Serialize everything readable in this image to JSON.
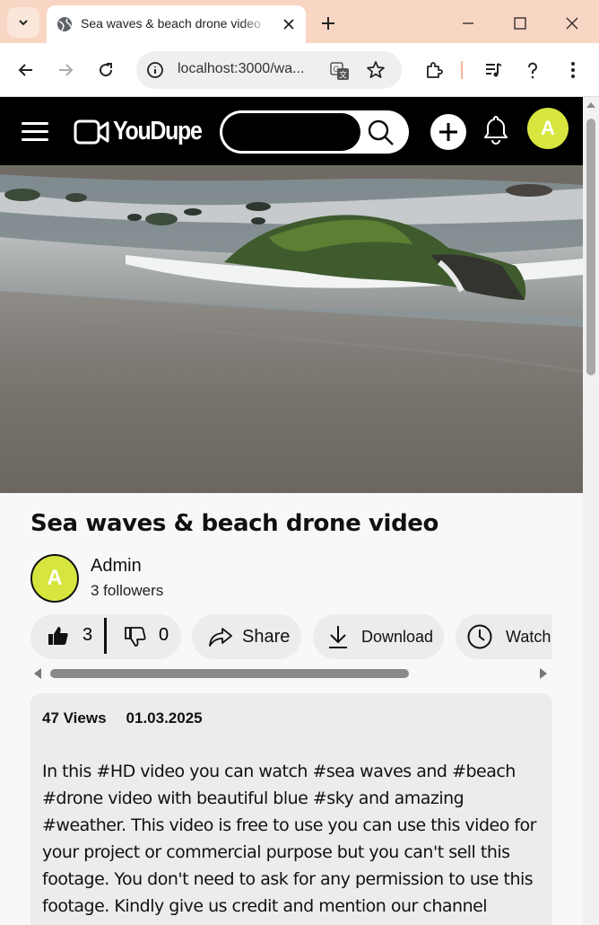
{
  "browser": {
    "tab_title": "Sea waves & beach drone video",
    "url": "localhost:3000/wa..."
  },
  "header": {
    "logo_text": "YouDupe",
    "search_value": "",
    "avatar_letter": "A"
  },
  "video": {
    "title": "Sea waves & beach drone video"
  },
  "channel": {
    "avatar_letter": "A",
    "name": "Admin",
    "followers": "3 followers"
  },
  "actions": {
    "likes": "3",
    "dislikes": "0",
    "share_label": "Share",
    "download_label": "Download",
    "watch_label": "Watch"
  },
  "description": {
    "views": "47 Views",
    "date": "01.03.2025",
    "text": "In this #HD video you can watch #sea waves and #beach #drone video with beautiful blue #sky and amazing #weather. This video is free to use you can use this video for your project or commercial purpose but you can't sell this footage. You don't need to ask for any permission to use this footage. Kindly give us credit and mention our channel link/Name &"
  },
  "colors": {
    "tabbar": "#f9d6c4",
    "avatar": "#d6e63f",
    "header": "#000000"
  }
}
